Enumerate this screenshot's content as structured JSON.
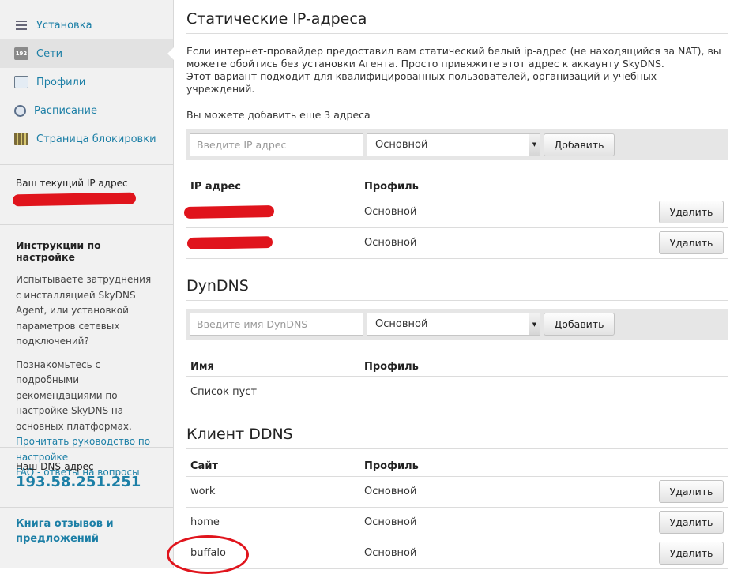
{
  "sidebar": {
    "nav": [
      {
        "label": "Установка",
        "icon": "list-icon"
      },
      {
        "label": "Сети",
        "icon": "network-icon",
        "active": true
      },
      {
        "label": "Профили",
        "icon": "profile-icon"
      },
      {
        "label": "Расписание",
        "icon": "clock-icon"
      },
      {
        "label": "Страница блокировки",
        "icon": "blockpage-icon"
      }
    ],
    "current_ip_label": "Ваш текущий IP адрес",
    "instructions": {
      "title": "Инструкции по настройке",
      "text1": "Испытываете затруднения с инсталляцией SkyDNS Agent, или установкой параметров сетевых подключений?",
      "text2": "Познакомьтесь с подробными рекомендациями по настройке SkyDNS на основных платформах.",
      "link_guide": "Прочитать руководство по настройке",
      "link_faq": "FAQ - ответы на вопросы"
    },
    "dns": {
      "label": "Наш DNS-адрес",
      "value": "193.58.251.251"
    },
    "feedback": "Книга отзывов и предложений"
  },
  "static_ip": {
    "title": "Статические IP-адреса",
    "desc_line1": "Если интернет-провайдер предоставил вам статический белый ip-адрес (не находящийся за NAT), вы можете обойтись без установки Агента. Просто привяжите этот адрес к аккаунту SkyDNS.",
    "desc_line2": "Этот вариант подходит для квалифицированных пользователей, организаций и учебных учреждений.",
    "more": "Вы можете добавить еще 3 адреса",
    "input_placeholder": "Введите IP адрес",
    "select_value": "Основной",
    "add_label": "Добавить",
    "col_ip": "IP адрес",
    "col_profile": "Профиль",
    "rows": [
      {
        "profile": "Основной",
        "delete": "Удалить"
      },
      {
        "profile": "Основной",
        "delete": "Удалить"
      }
    ]
  },
  "dyndns": {
    "title": "DynDNS",
    "input_placeholder": "Введите имя DynDNS",
    "select_value": "Основной",
    "add_label": "Добавить",
    "col_name": "Имя",
    "col_profile": "Профиль",
    "empty": "Список пуст"
  },
  "ddns": {
    "title": "Клиент DDNS",
    "col_site": "Сайт",
    "col_profile": "Профиль",
    "rows": [
      {
        "site": "work",
        "profile": "Основной",
        "delete": "Удалить"
      },
      {
        "site": "home",
        "profile": "Основной",
        "delete": "Удалить"
      },
      {
        "site": "buffalo",
        "profile": "Основной",
        "delete": "Удалить"
      }
    ]
  },
  "colors": {
    "link": "#1c7fa6",
    "annotation": "#e0141c",
    "sidebar_bg": "#f1f1f1"
  }
}
